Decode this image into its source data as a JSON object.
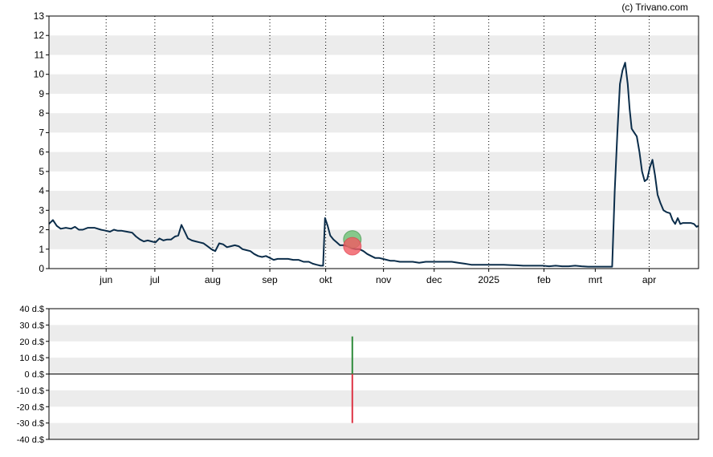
{
  "copyright": "(c) Trivano.com",
  "colors": {
    "line": "#0b2d4a",
    "band": "#ececec",
    "buy": "#2e8b3a",
    "sell": "#dd3344",
    "buy_marker": "#6dbf73",
    "sell_marker": "#f05a62"
  },
  "chart_data": [
    {
      "type": "line",
      "name": "price",
      "ylim": [
        0,
        13
      ],
      "yticks": [
        0,
        1,
        2,
        3,
        4,
        5,
        6,
        7,
        8,
        9,
        10,
        11,
        12,
        13
      ],
      "xlim": [
        0,
        100
      ],
      "month_labels": [
        {
          "label": "jun",
          "x": 8.8
        },
        {
          "label": "jul",
          "x": 16.3
        },
        {
          "label": "aug",
          "x": 25.2
        },
        {
          "label": "sep",
          "x": 34.0
        },
        {
          "label": "okt",
          "x": 42.6
        },
        {
          "label": "nov",
          "x": 51.5
        },
        {
          "label": "dec",
          "x": 59.3
        },
        {
          "label": "2025",
          "x": 67.7
        },
        {
          "label": "feb",
          "x": 76.2
        },
        {
          "label": "mrt",
          "x": 84.1
        },
        {
          "label": "apr",
          "x": 92.4
        }
      ],
      "points": [
        [
          0,
          2.3
        ],
        [
          0.6,
          2.5
        ],
        [
          1.2,
          2.2
        ],
        [
          1.8,
          2.05
        ],
        [
          2.6,
          2.1
        ],
        [
          3.4,
          2.05
        ],
        [
          4.0,
          2.15
        ],
        [
          4.6,
          2.0
        ],
        [
          5.2,
          2.0
        ],
        [
          6.0,
          2.1
        ],
        [
          7.0,
          2.1
        ],
        [
          8.0,
          2.0
        ],
        [
          8.8,
          1.95
        ],
        [
          9.4,
          1.9
        ],
        [
          10.0,
          2.0
        ],
        [
          10.6,
          1.95
        ],
        [
          11.2,
          1.95
        ],
        [
          12.0,
          1.9
        ],
        [
          12.8,
          1.85
        ],
        [
          13.4,
          1.65
        ],
        [
          14.0,
          1.5
        ],
        [
          14.6,
          1.4
        ],
        [
          15.2,
          1.45
        ],
        [
          15.8,
          1.4
        ],
        [
          16.4,
          1.35
        ],
        [
          17.0,
          1.55
        ],
        [
          17.6,
          1.45
        ],
        [
          18.2,
          1.5
        ],
        [
          18.8,
          1.5
        ],
        [
          19.4,
          1.65
        ],
        [
          19.9,
          1.7
        ],
        [
          20.4,
          2.25
        ],
        [
          20.9,
          1.9
        ],
        [
          21.4,
          1.55
        ],
        [
          22.0,
          1.45
        ],
        [
          22.6,
          1.4
        ],
        [
          23.2,
          1.35
        ],
        [
          23.8,
          1.3
        ],
        [
          24.4,
          1.15
        ],
        [
          25.0,
          1.0
        ],
        [
          25.6,
          0.9
        ],
        [
          26.2,
          1.3
        ],
        [
          26.8,
          1.25
        ],
        [
          27.4,
          1.1
        ],
        [
          28.0,
          1.15
        ],
        [
          28.6,
          1.2
        ],
        [
          29.2,
          1.15
        ],
        [
          29.8,
          1.0
        ],
        [
          30.4,
          0.95
        ],
        [
          31.0,
          0.9
        ],
        [
          31.6,
          0.75
        ],
        [
          32.2,
          0.65
        ],
        [
          32.8,
          0.6
        ],
        [
          33.4,
          0.65
        ],
        [
          34.0,
          0.55
        ],
        [
          34.6,
          0.45
        ],
        [
          35.2,
          0.5
        ],
        [
          36.0,
          0.5
        ],
        [
          36.8,
          0.5
        ],
        [
          37.6,
          0.45
        ],
        [
          38.4,
          0.45
        ],
        [
          39.2,
          0.35
        ],
        [
          40.0,
          0.35
        ],
        [
          40.6,
          0.25
        ],
        [
          41.2,
          0.2
        ],
        [
          41.8,
          0.15
        ],
        [
          42.2,
          0.15
        ],
        [
          42.5,
          2.6
        ],
        [
          42.9,
          2.2
        ],
        [
          43.3,
          1.7
        ],
        [
          43.8,
          1.5
        ],
        [
          44.3,
          1.35
        ],
        [
          44.8,
          1.2
        ],
        [
          45.4,
          1.2
        ],
        [
          46.0,
          1.15
        ],
        [
          46.6,
          1.05
        ],
        [
          47.2,
          1.0
        ],
        [
          47.8,
          1.0
        ],
        [
          48.4,
          0.9
        ],
        [
          49.0,
          0.75
        ],
        [
          49.6,
          0.65
        ],
        [
          50.2,
          0.55
        ],
        [
          50.8,
          0.55
        ],
        [
          51.4,
          0.5
        ],
        [
          52.0,
          0.45
        ],
        [
          52.6,
          0.4
        ],
        [
          53.2,
          0.4
        ],
        [
          54.0,
          0.35
        ],
        [
          55.0,
          0.35
        ],
        [
          56.0,
          0.35
        ],
        [
          57.0,
          0.3
        ],
        [
          58.0,
          0.35
        ],
        [
          59.0,
          0.35
        ],
        [
          60.0,
          0.35
        ],
        [
          61.0,
          0.35
        ],
        [
          62.0,
          0.35
        ],
        [
          63.0,
          0.3
        ],
        [
          64.0,
          0.25
        ],
        [
          65.0,
          0.2
        ],
        [
          66.0,
          0.2
        ],
        [
          67.0,
          0.2
        ],
        [
          68.0,
          0.2
        ],
        [
          69.0,
          0.2
        ],
        [
          70.0,
          0.2
        ],
        [
          71.0,
          0.18
        ],
        [
          72.0,
          0.17
        ],
        [
          73.0,
          0.15
        ],
        [
          74.0,
          0.15
        ],
        [
          75.0,
          0.15
        ],
        [
          76.0,
          0.15
        ],
        [
          77.0,
          0.12
        ],
        [
          78.0,
          0.15
        ],
        [
          79.0,
          0.12
        ],
        [
          80.0,
          0.12
        ],
        [
          81.0,
          0.15
        ],
        [
          82.0,
          0.12
        ],
        [
          83.0,
          0.1
        ],
        [
          84.0,
          0.1
        ],
        [
          85.0,
          0.1
        ],
        [
          86.0,
          0.1
        ],
        [
          86.7,
          0.1
        ],
        [
          87.1,
          4.0
        ],
        [
          87.5,
          7.0
        ],
        [
          87.9,
          9.5
        ],
        [
          88.3,
          10.2
        ],
        [
          88.7,
          10.6
        ],
        [
          89.1,
          9.5
        ],
        [
          89.4,
          8.2
        ],
        [
          89.7,
          7.2
        ],
        [
          90.1,
          7.0
        ],
        [
          90.5,
          6.8
        ],
        [
          90.9,
          6.0
        ],
        [
          91.3,
          5.0
        ],
        [
          91.7,
          4.5
        ],
        [
          92.1,
          4.6
        ],
        [
          92.5,
          5.2
        ],
        [
          92.9,
          5.6
        ],
        [
          93.3,
          4.8
        ],
        [
          93.7,
          3.8
        ],
        [
          94.1,
          3.4
        ],
        [
          94.6,
          3.0
        ],
        [
          95.1,
          2.9
        ],
        [
          95.6,
          2.85
        ],
        [
          96.0,
          2.5
        ],
        [
          96.4,
          2.3
        ],
        [
          96.8,
          2.6
        ],
        [
          97.2,
          2.3
        ],
        [
          97.6,
          2.35
        ],
        [
          98.2,
          2.35
        ],
        [
          98.8,
          2.35
        ],
        [
          99.3,
          2.3
        ],
        [
          99.7,
          2.15
        ],
        [
          100,
          2.2
        ]
      ],
      "signals": [
        {
          "type": "buy",
          "x": 46.7,
          "y": 1.5
        },
        {
          "type": "sell",
          "x": 46.7,
          "y": 1.15
        }
      ]
    },
    {
      "type": "bar",
      "name": "signal-result",
      "ylim": [
        -40,
        40
      ],
      "yticks": [
        40,
        30,
        20,
        10,
        0,
        -10,
        -20,
        -30,
        -40
      ],
      "ytick_labels": [
        "40 d.$",
        "30 d.$",
        "20 d.$",
        "10 d.$",
        "0 d.$",
        "-10 d.$",
        "-20 d.$",
        "-30 d.$",
        "-40 d.$"
      ],
      "xlim": [
        0,
        100
      ],
      "bars": [
        {
          "x": 46.7,
          "value": 23,
          "kind": "buy"
        },
        {
          "x": 46.7,
          "value": -30,
          "kind": "sell"
        }
      ]
    }
  ]
}
